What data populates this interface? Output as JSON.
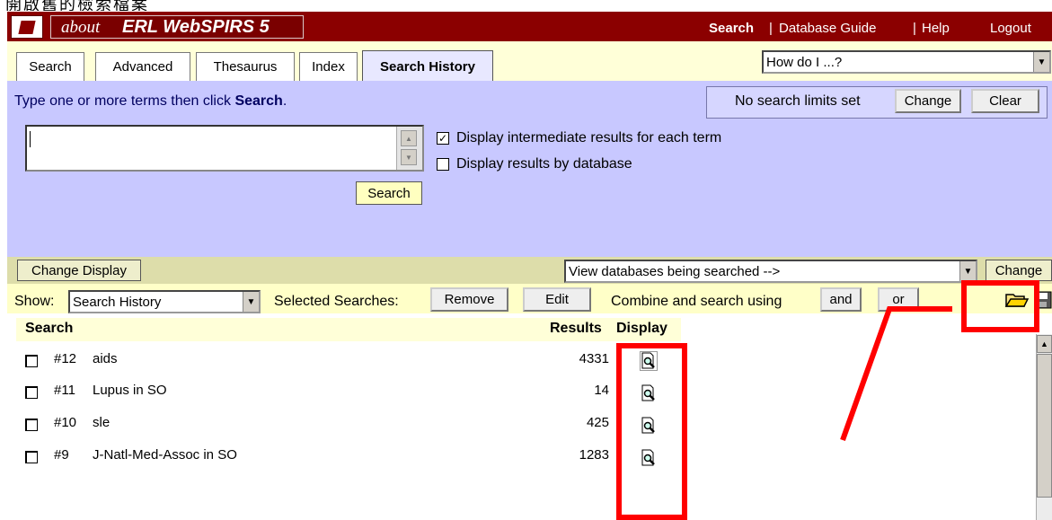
{
  "caption": "開啟舊的檢索檔案",
  "header": {
    "about": "about",
    "brand": "ERL WebSPIRS 5",
    "links": {
      "search": "Search",
      "sep1": "|",
      "database_guide": "Database Guide",
      "sep2": "|",
      "help": "Help",
      "logout": "Logout"
    }
  },
  "tabs": [
    {
      "label": "Search"
    },
    {
      "label": "Advanced"
    },
    {
      "label": "Thesaurus"
    },
    {
      "label": "Index"
    },
    {
      "label": "Search History",
      "active": true
    }
  ],
  "howdoi": {
    "selected": "How do I ...?"
  },
  "search_panel": {
    "hint_prefix": "Type one or more terms then click ",
    "hint_bold": "Search",
    "hint_suffix": ".",
    "limits_text": "No search limits set",
    "change_label": "Change",
    "clear_label": "Clear",
    "search_button": "Search",
    "options": [
      {
        "label": "Display intermediate results for each term",
        "checked": true
      },
      {
        "label": "Display results by database",
        "checked": false
      }
    ]
  },
  "display_bar": {
    "change_display": "Change Display",
    "databases_select": "View databases being searched  -->",
    "change_label": "Change"
  },
  "show_bar": {
    "show_label": "Show:",
    "show_select": "Search History",
    "selected_label": "Selected Searches:",
    "remove": "Remove",
    "edit": "Edit",
    "combine_label": "Combine and search using",
    "and": "and",
    "or": "or"
  },
  "history": {
    "columns": {
      "search": "Search",
      "results": "Results",
      "display": "Display"
    },
    "rows": [
      {
        "num": "#12",
        "query": "aids",
        "results": "4331"
      },
      {
        "num": "#11",
        "query": "Lupus in SO",
        "results": "14"
      },
      {
        "num": "#10",
        "query": "sle",
        "results": "425"
      },
      {
        "num": "#9",
        "query": "J-Natl-Med-Assoc in SO",
        "results": "1283"
      }
    ]
  },
  "colors": {
    "header_bg": "#8b0000",
    "panel_bg": "#c8c8ff",
    "annotation": "#ff0000"
  },
  "icons": [
    "open-folder-icon",
    "save-disk-icon",
    "magnifier-document-icon",
    "dropdown-arrow-icon",
    "scroll-up-arrow-icon"
  ]
}
